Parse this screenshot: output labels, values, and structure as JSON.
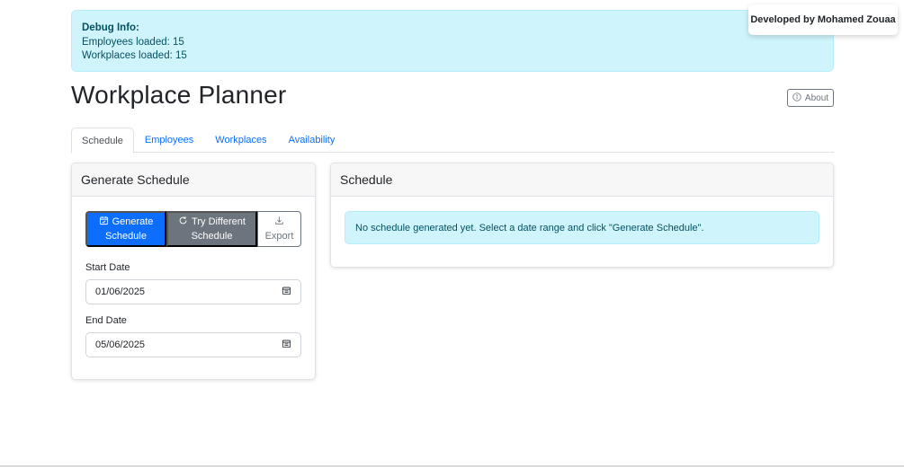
{
  "debug": {
    "title": "Debug Info:",
    "employees_line": "Employees loaded: 15",
    "workplaces_line": "Workplaces loaded: 15"
  },
  "credit": "Developed by Mohamed Zouaa",
  "page_title": "Workplace Planner",
  "about_button": {
    "label": "About",
    "icon": "info-circle-icon"
  },
  "tabs": [
    {
      "label": "Schedule",
      "active": true
    },
    {
      "label": "Employees",
      "active": false
    },
    {
      "label": "Workplaces",
      "active": false
    },
    {
      "label": "Availability",
      "active": false
    }
  ],
  "generate_panel": {
    "title": "Generate Schedule",
    "generate_button": {
      "line1": "Generate",
      "line2": "Schedule",
      "icon": "calendar-check-icon"
    },
    "try_button": {
      "line1": "Try Different",
      "line2": "Schedule",
      "icon": "refresh-icon"
    },
    "export_button": {
      "label": "Export",
      "icon": "download-icon"
    },
    "start_date": {
      "label": "Start Date",
      "value": "01/06/2025"
    },
    "end_date": {
      "label": "End Date",
      "value": "05/06/2025"
    }
  },
  "schedule_panel": {
    "title": "Schedule",
    "empty_message": "No schedule generated yet. Select a date range and click \"Generate Schedule\"."
  },
  "colors": {
    "primary": "#0d6efd",
    "secondary": "#6c757d",
    "info_bg": "#cff4fc",
    "info_text": "#055160"
  }
}
